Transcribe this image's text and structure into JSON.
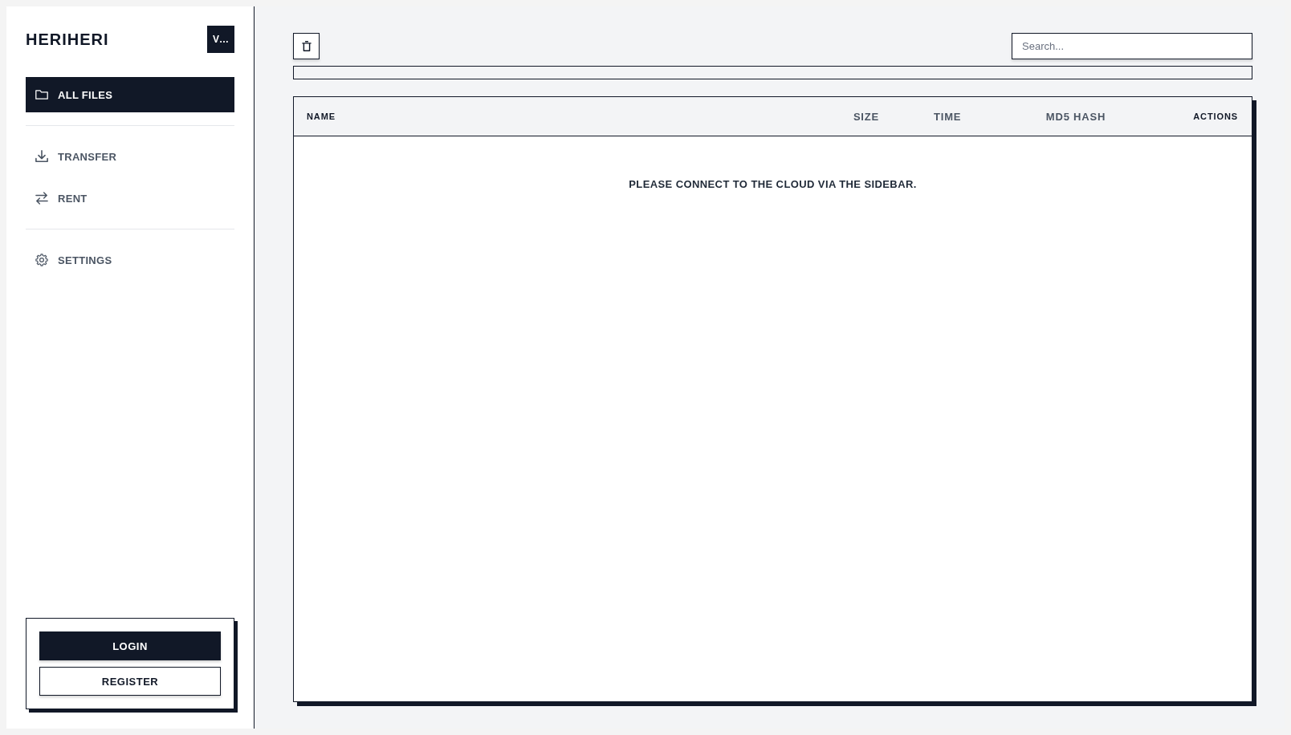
{
  "sidebar": {
    "title": "HERIHERI",
    "header_button": "V…",
    "groups": [
      {
        "items": [
          {
            "label": "ALL FILES",
            "selected": true
          }
        ]
      },
      {
        "items": [
          {
            "label": "TRANSFER",
            "selected": false
          },
          {
            "label": "RENT",
            "selected": false
          }
        ]
      },
      {
        "items": [
          {
            "label": "SETTINGS",
            "selected": false
          }
        ]
      }
    ],
    "auth_buttons": [
      {
        "label": "LOGIN",
        "kind": "primary"
      },
      {
        "label": "REGISTER",
        "kind": "secondary"
      }
    ]
  },
  "toolbar": {
    "search": {
      "placeholder": "Search..."
    }
  },
  "progress": {
    "level": 0
  },
  "table": {
    "columns": [
      {
        "label": "NAME",
        "kind": "strong"
      },
      {
        "label": "SIZE",
        "kind": "muted"
      },
      {
        "label": "TIME",
        "kind": "muted"
      },
      {
        "label": "MD5 HASH",
        "kind": "muted"
      },
      {
        "label": "ACTIONS",
        "kind": "strong"
      }
    ],
    "empty_message": "PLEASE CONNECT TO THE CLOUD VIA THE SIDEBAR."
  }
}
